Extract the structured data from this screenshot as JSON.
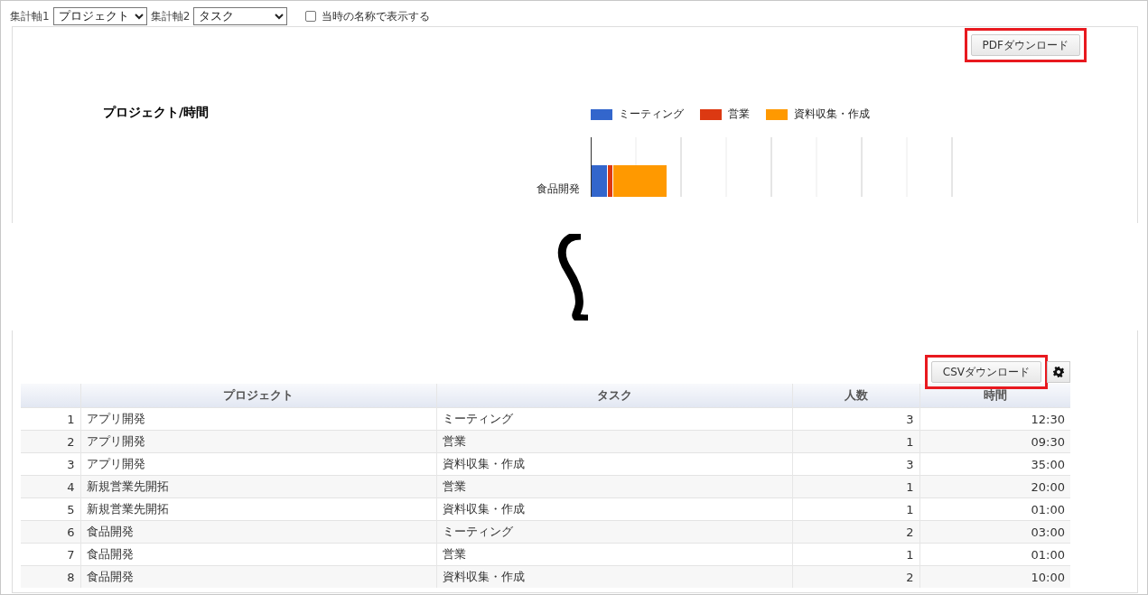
{
  "toolbar": {
    "axis1_label": "集計軸1",
    "axis1_value": "プロジェクト",
    "axis2_label": "集計軸2",
    "axis2_value": "タスク",
    "checkbox": {
      "label": "当時の名称で表示する",
      "checked": false
    }
  },
  "chart_panel": {
    "download_button": {
      "label": "PDFダウンロード",
      "highlighted": true
    },
    "title": "プロジェクト/時間",
    "legend": [
      {
        "label": "ミーティング",
        "color": "#3366cc"
      },
      {
        "label": "営業",
        "color": "#dc3912"
      },
      {
        "label": "資料収集・作成",
        "color": "#ff9900"
      }
    ],
    "category_label": "食品開発"
  },
  "table_panel": {
    "download_button": {
      "label": "CSVダウンロード",
      "highlighted": true
    },
    "columns": [
      "プロジェクト",
      "タスク",
      "人数",
      "時間"
    ],
    "rows": [
      {
        "index": "1",
        "project": "アプリ開発",
        "task": "ミーティング",
        "people": "3",
        "time": "12:30"
      },
      {
        "index": "2",
        "project": "アプリ開発",
        "task": "営業",
        "people": "1",
        "time": "09:30"
      },
      {
        "index": "3",
        "project": "アプリ開発",
        "task": "資料収集・作成",
        "people": "3",
        "time": "35:00"
      },
      {
        "index": "4",
        "project": "新規営業先開拓",
        "task": "営業",
        "people": "1",
        "time": "20:00"
      },
      {
        "index": "5",
        "project": "新規営業先開拓",
        "task": "資料収集・作成",
        "people": "1",
        "time": "01:00"
      },
      {
        "index": "6",
        "project": "食品開発",
        "task": "ミーティング",
        "people": "2",
        "time": "03:00"
      },
      {
        "index": "7",
        "project": "食品開発",
        "task": "営業",
        "people": "1",
        "time": "01:00"
      },
      {
        "index": "8",
        "project": "食品開発",
        "task": "資料収集・作成",
        "people": "2",
        "time": "10:00"
      }
    ]
  }
}
